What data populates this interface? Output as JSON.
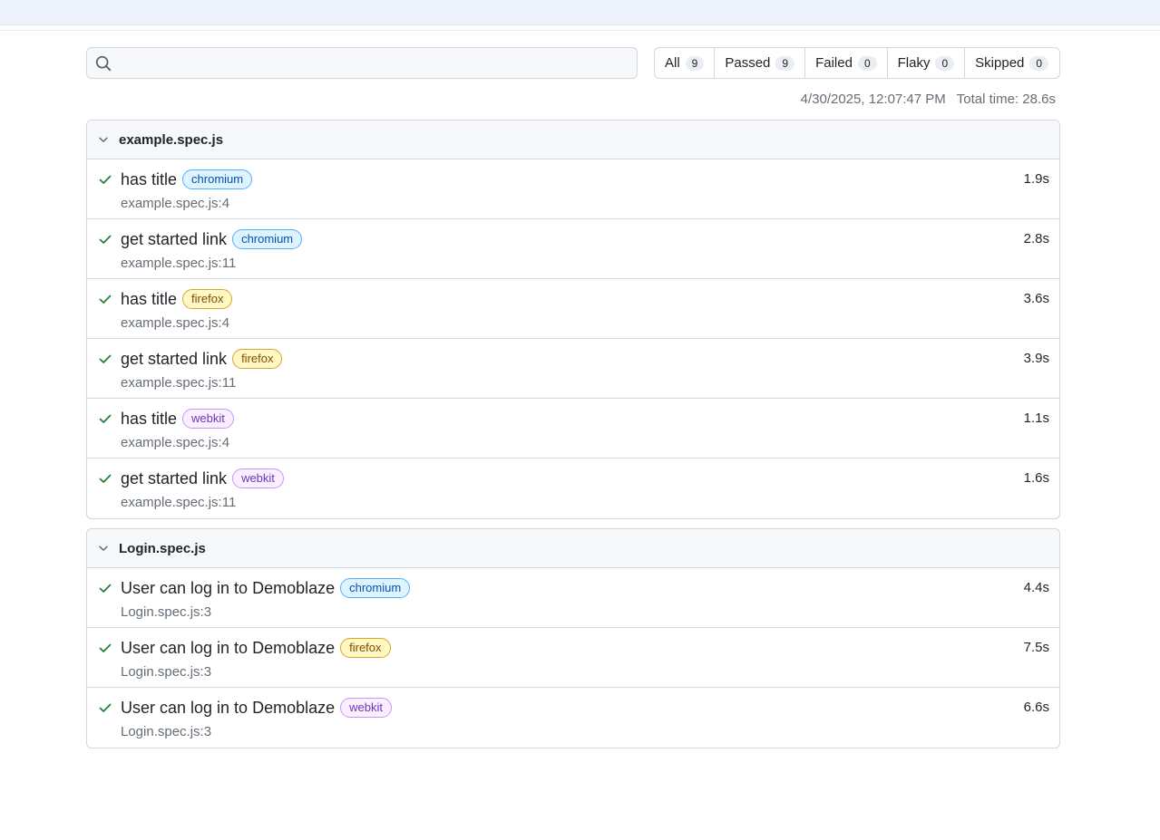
{
  "search": {
    "placeholder": "",
    "value": ""
  },
  "filters": [
    {
      "label": "All",
      "count": "9"
    },
    {
      "label": "Passed",
      "count": "9"
    },
    {
      "label": "Failed",
      "count": "0"
    },
    {
      "label": "Flaky",
      "count": "0"
    },
    {
      "label": "Skipped",
      "count": "0"
    }
  ],
  "meta": {
    "timestamp": "4/30/2025, 12:07:47 PM",
    "total_time": "Total time: 28.6s"
  },
  "files": [
    {
      "name": "example.spec.js",
      "tests": [
        {
          "title": "has title",
          "project": "chromium",
          "location": "example.spec.js:4",
          "duration": "1.9s"
        },
        {
          "title": "get started link",
          "project": "chromium",
          "location": "example.spec.js:11",
          "duration": "2.8s"
        },
        {
          "title": "has title",
          "project": "firefox",
          "location": "example.spec.js:4",
          "duration": "3.6s"
        },
        {
          "title": "get started link",
          "project": "firefox",
          "location": "example.spec.js:11",
          "duration": "3.9s"
        },
        {
          "title": "has title",
          "project": "webkit",
          "location": "example.spec.js:4",
          "duration": "1.1s"
        },
        {
          "title": "get started link",
          "project": "webkit",
          "location": "example.spec.js:11",
          "duration": "1.6s"
        }
      ]
    },
    {
      "name": "Login.spec.js",
      "tests": [
        {
          "title": "User can log in to Demoblaze",
          "project": "chromium",
          "location": "Login.spec.js:3",
          "duration": "4.4s"
        },
        {
          "title": "User can log in to Demoblaze",
          "project": "firefox",
          "location": "Login.spec.js:3",
          "duration": "7.5s"
        },
        {
          "title": "User can log in to Demoblaze",
          "project": "webkit",
          "location": "Login.spec.js:3",
          "duration": "6.6s"
        }
      ]
    }
  ],
  "colors": {
    "passed": "#1a7f37",
    "chromium": "#54aeff",
    "firefox": "#d4a72c",
    "webkit": "#c297ff"
  },
  "icons": {
    "search": "search-icon",
    "expand": "chevron-down-icon",
    "status": "check-icon"
  }
}
